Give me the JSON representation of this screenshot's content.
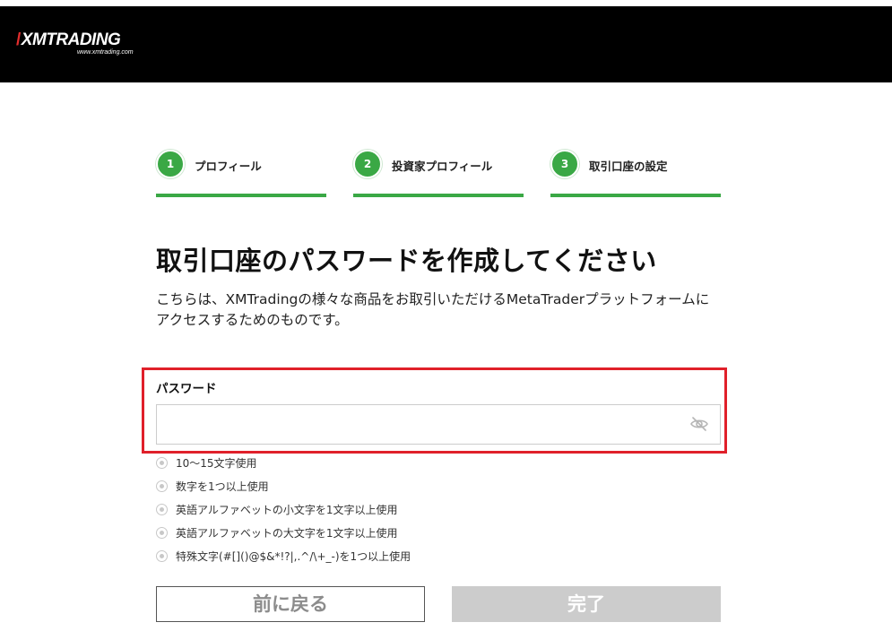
{
  "header": {
    "logo_text": "XMTRADING",
    "logo_url_text": "www.xmtrading.com"
  },
  "steps": [
    {
      "number": "1",
      "label": "プロフィール"
    },
    {
      "number": "2",
      "label": "投資家プロフィール"
    },
    {
      "number": "3",
      "label": "取引口座の設定"
    }
  ],
  "main": {
    "title": "取引口座のパスワードを作成してください",
    "description_line1": "こちらは、XMTradingの様々な商品をお取引いただけるMetaTraderプラットフォームに",
    "description_line2": "アクセスするためのものです。"
  },
  "password": {
    "label": "パスワード",
    "value": "",
    "placeholder": ""
  },
  "requirements": [
    "10〜15文字使用",
    "数字を1つ以上使用",
    "英語アルファベットの小文字を1文字以上使用",
    "英語アルファベットの大文字を1文字以上使用",
    "特殊文字(#[]()@$&*!?|,.^/\\+_-)を1つ以上使用"
  ],
  "buttons": {
    "back_label": "前に戻る",
    "done_label": "完了"
  },
  "colors": {
    "accent_green": "#3aa845",
    "highlight_red": "#e0202a",
    "header_bg": "#000000",
    "disabled_button": "#cccccc"
  },
  "icons": {
    "password_toggle": "eye-slash-icon",
    "requirement_marker": "radio-dot-icon"
  }
}
